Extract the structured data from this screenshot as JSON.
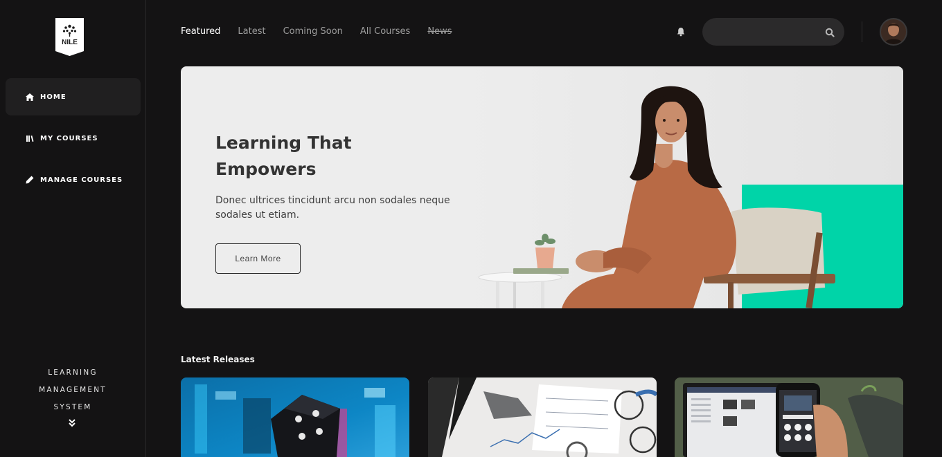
{
  "app": {
    "logo_text": "NILE"
  },
  "sidebar": {
    "items": [
      {
        "label": "HOME",
        "icon": "home-icon",
        "active": true
      },
      {
        "label": "MY COURSES",
        "icon": "books-icon",
        "active": false
      },
      {
        "label": "MANAGE COURSES",
        "icon": "pencil-icon",
        "active": false
      }
    ],
    "footer": {
      "line1": "LEARNING",
      "line2": "MANAGEMENT",
      "line3": "SYSTEM",
      "icon": "chevron-double-down-icon"
    }
  },
  "topnav": {
    "tabs": [
      {
        "label": "Featured",
        "active": true
      },
      {
        "label": "Latest",
        "active": false
      },
      {
        "label": "Coming Soon",
        "active": false
      },
      {
        "label": "All Courses",
        "active": false
      },
      {
        "label": "News",
        "active": false,
        "strikethrough": true
      }
    ]
  },
  "search": {
    "placeholder": "",
    "value": ""
  },
  "hero": {
    "title_line1": "Learning That",
    "title_line2": "Empowers",
    "description": "Donec ultrices tincidunt arcu non sodales neque sodales ut etiam.",
    "button_label": "Learn More"
  },
  "latest": {
    "title": "Latest Releases"
  },
  "colors": {
    "accent": "#00d4a8",
    "background": "#141314",
    "sidebar_active": "#201f20",
    "hero_bg": "#ededed"
  }
}
